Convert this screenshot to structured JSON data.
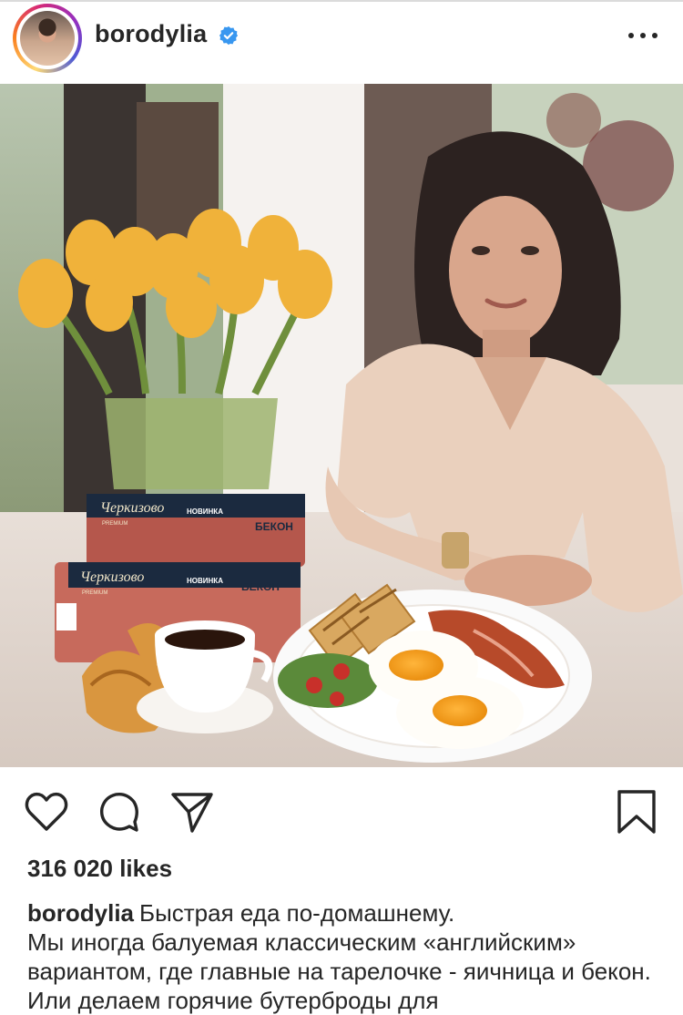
{
  "post": {
    "username": "borodylia",
    "verified": true,
    "likes": "316 020 likes",
    "caption_user": "borodylia",
    "caption_first_line": "Быстрая еда по-домашнему.",
    "caption_body": "Мы иногда балуемая классическим «английским» вариантом, где главные на тарелочке - яичница и бекон. Или делаем горячие бутерброды для"
  },
  "photo": {
    "packages": [
      {
        "brand": "Черкизово",
        "sub": "PREMIUM",
        "tag": "НОВИНКА",
        "product": "БЕКОН"
      },
      {
        "brand": "Черкизово",
        "sub": "PREMIUM",
        "tag": "НОВИНКА",
        "product": "БЕКОН"
      }
    ]
  },
  "icons": [
    "like-heart-icon",
    "comment-icon",
    "share-icon",
    "save-bookmark-icon",
    "verified-badge-icon",
    "more-options-icon"
  ],
  "colors": {
    "text": "#262626",
    "verified": "#3897f0",
    "ring": [
      "#feda75",
      "#fa7e1e",
      "#d62976",
      "#962fbf"
    ]
  }
}
